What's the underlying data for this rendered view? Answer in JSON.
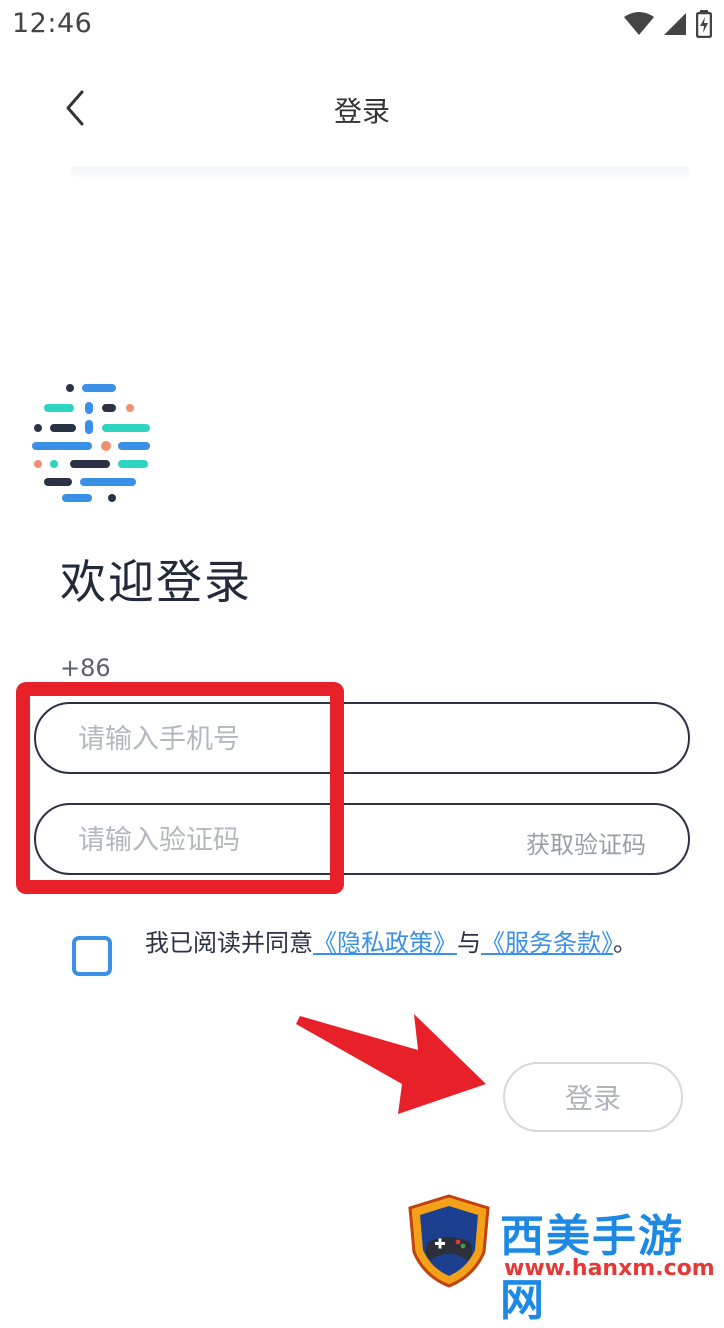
{
  "status_bar": {
    "time": "12:46"
  },
  "header": {
    "title": "登录"
  },
  "welcome": "欢迎登录",
  "country_code": "+86",
  "phone": {
    "placeholder": "请输入手机号",
    "value": ""
  },
  "code": {
    "placeholder": "请输入验证码",
    "value": "",
    "get_code_label": "获取验证码"
  },
  "agreement": {
    "checked": false,
    "prefix": "我已阅读并同意",
    "privacy_link": "《隐私政策》",
    "connector": "与",
    "terms_link": "《服务条款》",
    "suffix": "。"
  },
  "login_button": "登录",
  "watermark": {
    "title": "西美手游网",
    "url": "www.hanxm.com"
  },
  "colors": {
    "accent": "#3a8fe6",
    "annotation": "#e8202a",
    "text": "#2b3245"
  }
}
